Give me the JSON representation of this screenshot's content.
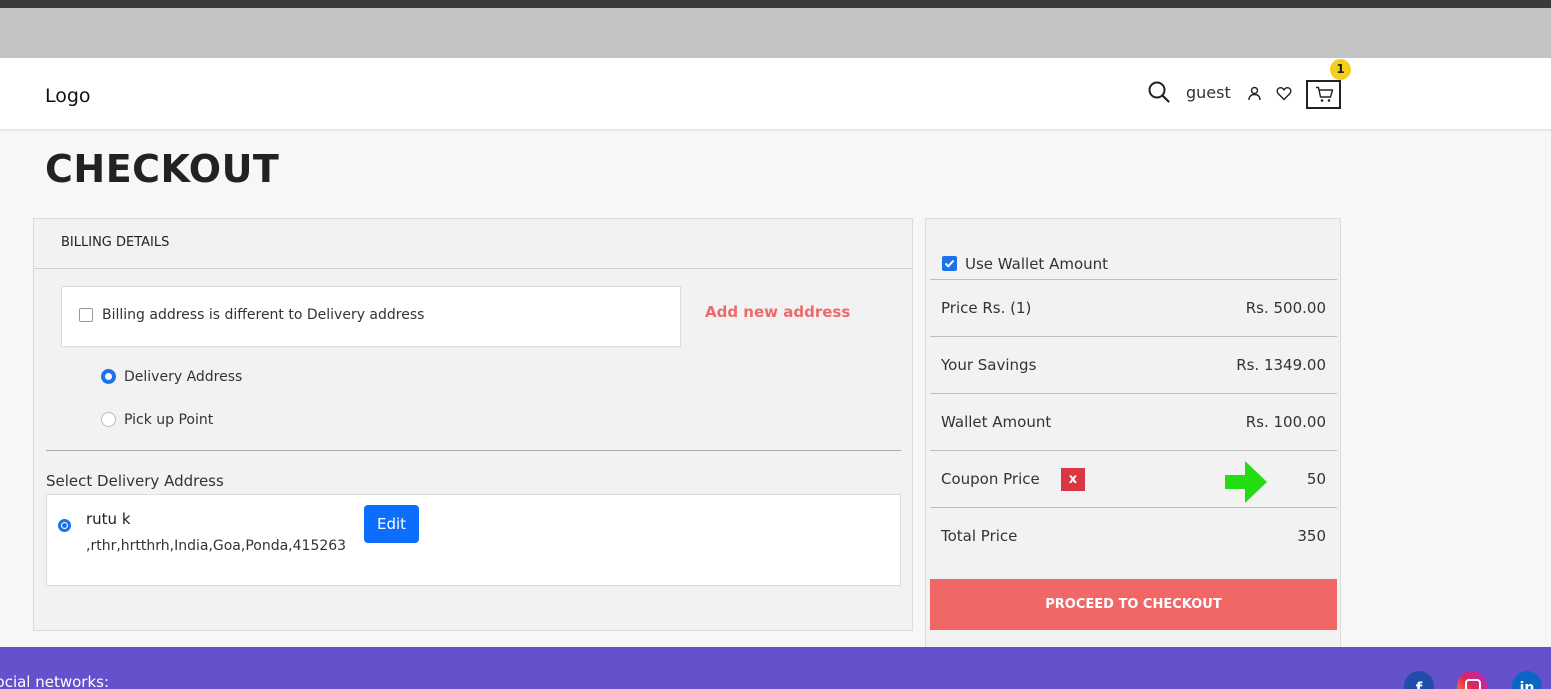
{
  "header": {
    "logo": "Logo",
    "user_label": "guest",
    "cart_count": "1"
  },
  "page": {
    "title": "CHECKOUT"
  },
  "billing": {
    "heading": "BILLING DETAILS",
    "different_address_label": "Billing address is different to Delivery address",
    "add_new_address": "Add new address",
    "delivery_options": [
      {
        "label": "Delivery Address",
        "selected": true
      },
      {
        "label": "Pick up Point",
        "selected": false
      }
    ],
    "select_delivery_label": "Select Delivery Address",
    "address": {
      "name": "rutu k",
      "line": ",rthr,hrtthrh,India,Goa,Ponda,415263",
      "edit_label": "Edit"
    }
  },
  "summary": {
    "use_wallet_label": "Use Wallet Amount",
    "use_wallet_checked": true,
    "rows": [
      {
        "label": "Price Rs. (1)",
        "value": "Rs. 500.00"
      },
      {
        "label": "Your Savings",
        "value": "Rs. 1349.00"
      },
      {
        "label": "Wallet Amount",
        "value": "Rs. 100.00"
      },
      {
        "label": "Coupon Price",
        "value": "50",
        "remove_label": "x"
      },
      {
        "label": "Total Price",
        "value": "350"
      }
    ],
    "checkout_button": "PROCEED TO CHECKOUT"
  },
  "footer": {
    "networks_label": "Social networks:",
    "social_icons": [
      "facebook-icon",
      "instagram-icon",
      "linkedin-icon"
    ]
  },
  "colors": {
    "accent_red": "#f06766",
    "primary_blue": "#0d6efd",
    "footer_purple": "#6551cc",
    "annotation_green": "#22dd11"
  }
}
